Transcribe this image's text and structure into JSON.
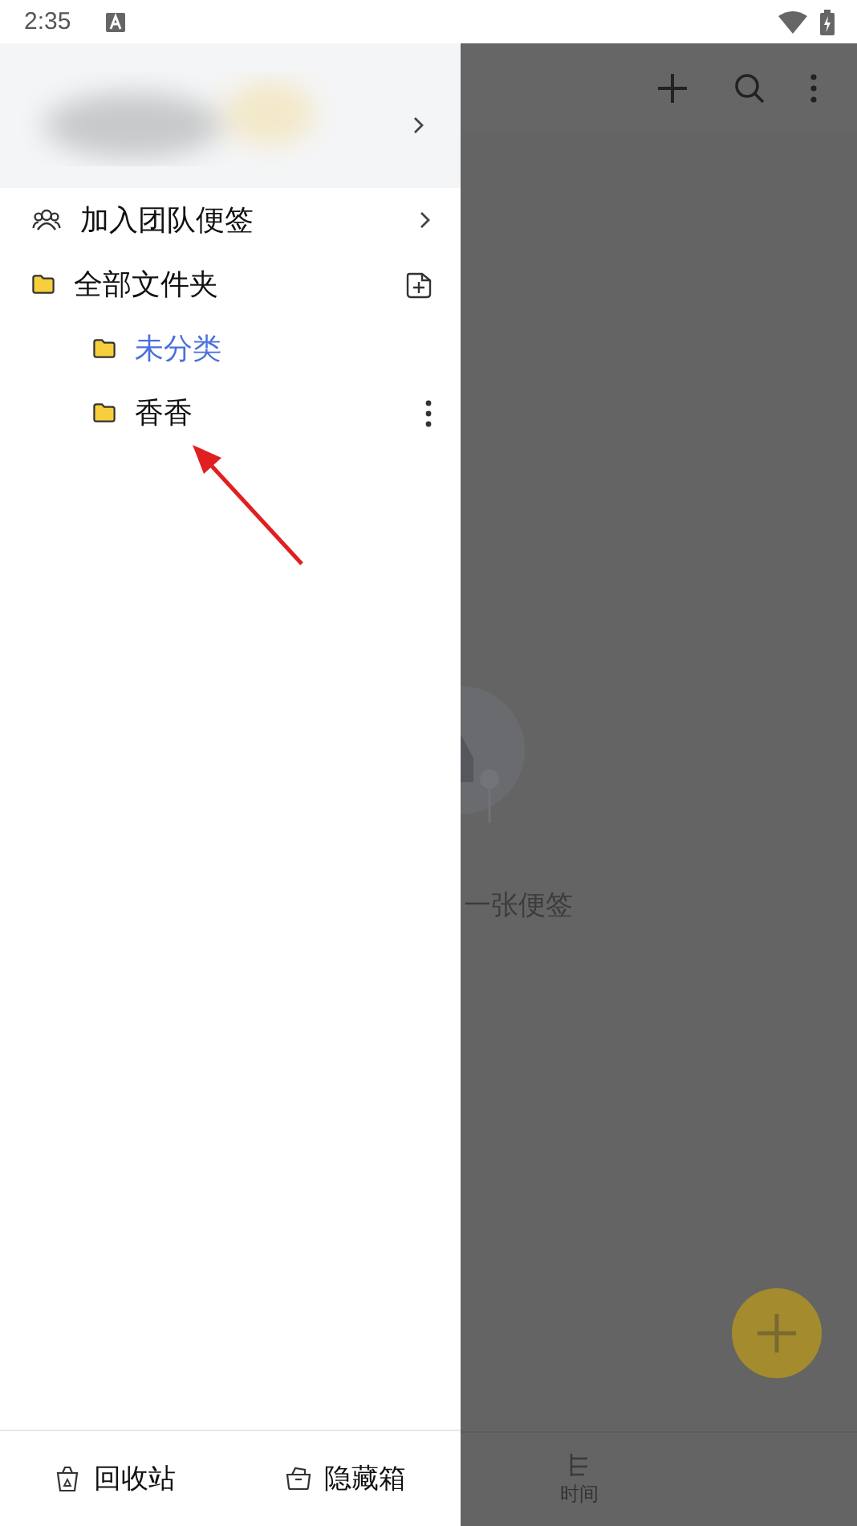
{
  "status_bar": {
    "time": "2:35"
  },
  "drawer": {
    "team_link": {
      "label": "加入团队便签"
    },
    "folders": {
      "label": "全部文件夹",
      "children": [
        {
          "label": "未分类",
          "selected": true,
          "has_menu": false
        },
        {
          "label": "香香",
          "selected": false,
          "has_menu": true
        }
      ]
    },
    "footer": [
      {
        "kind": "trash",
        "label": "回收站"
      },
      {
        "kind": "hidden",
        "label": "隐藏箱"
      }
    ]
  },
  "main": {
    "empty_text": "一张便签",
    "bottom_nav": [
      {
        "label": "时间"
      }
    ]
  }
}
